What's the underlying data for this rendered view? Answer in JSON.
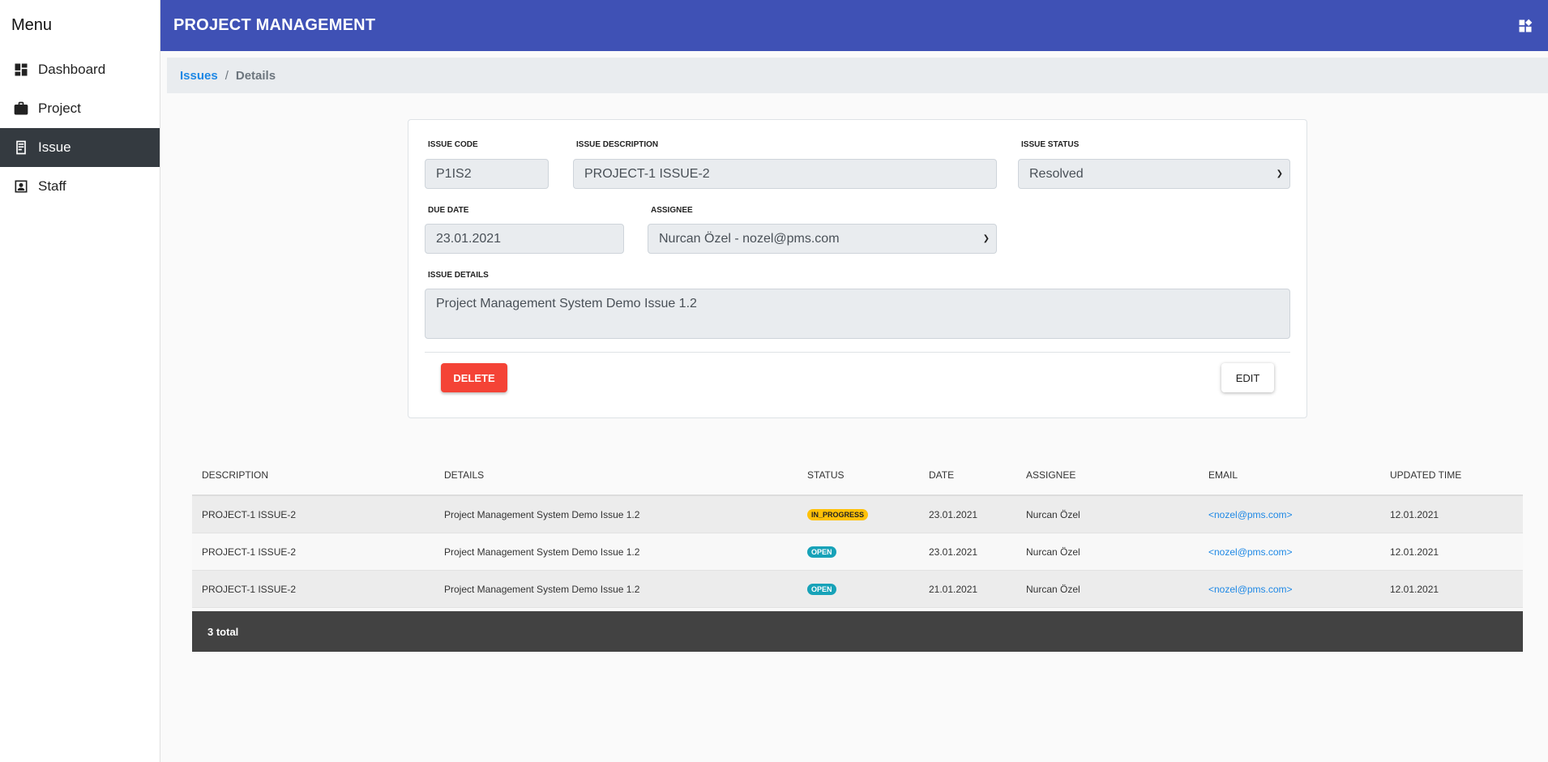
{
  "sidebar": {
    "title": "Menu",
    "items": [
      {
        "label": "Dashboard",
        "icon": "dashboard-icon"
      },
      {
        "label": "Project",
        "icon": "briefcase-icon"
      },
      {
        "label": "Issue",
        "icon": "issue-icon",
        "active": true
      },
      {
        "label": "Staff",
        "icon": "staff-icon"
      }
    ]
  },
  "header": {
    "title": "PROJECT MANAGEMENT",
    "color": "#3f51b5"
  },
  "breadcrumb": {
    "link": "Issues",
    "separator": "/",
    "current": "Details"
  },
  "form": {
    "issue_code": {
      "label": "ISSUE CODE",
      "value": "P1IS2"
    },
    "issue_description": {
      "label": "ISSUE DESCRIPTION",
      "value": "PROJECT-1 ISSUE-2"
    },
    "issue_status": {
      "label": "ISSUE STATUS",
      "value": "Resolved"
    },
    "due_date": {
      "label": "DUE DATE",
      "value": "23.01.2021"
    },
    "assignee": {
      "label": "ASSIGNEE",
      "value": "Nurcan Özel - nozel@pms.com"
    },
    "issue_details": {
      "label": "ISSUE DETAILS",
      "value": "Project Management System Demo Issue 1.2"
    },
    "delete_label": "DELETE",
    "edit_label": "EDIT",
    "delete_color": "#f44336"
  },
  "table": {
    "headers": [
      "DESCRIPTION",
      "DETAILS",
      "STATUS",
      "DATE",
      "ASSIGNEE",
      "EMAIL",
      "UPDATED TIME"
    ],
    "rows": [
      {
        "description": "PROJECT-1 ISSUE-2",
        "details": "Project Management System Demo Issue 1.2",
        "status": "IN_PROGRESS",
        "date": "23.01.2021",
        "assignee": "Nurcan Özel",
        "email": "<nozel@pms.com>",
        "updated": "12.01.2021"
      },
      {
        "description": "PROJECT-1 ISSUE-2",
        "details": "Project Management System Demo Issue 1.2",
        "status": "OPEN",
        "date": "23.01.2021",
        "assignee": "Nurcan Özel",
        "email": "<nozel@pms.com>",
        "updated": "12.01.2021"
      },
      {
        "description": "PROJECT-1 ISSUE-2",
        "details": "Project Management System Demo Issue 1.2",
        "status": "OPEN",
        "date": "21.01.2021",
        "assignee": "Nurcan Özel",
        "email": "<nozel@pms.com>",
        "updated": "12.01.2021"
      }
    ],
    "footer": "3 total",
    "status_colors": {
      "IN_PROGRESS": "#ffc107",
      "OPEN": "#17a2b8"
    }
  }
}
